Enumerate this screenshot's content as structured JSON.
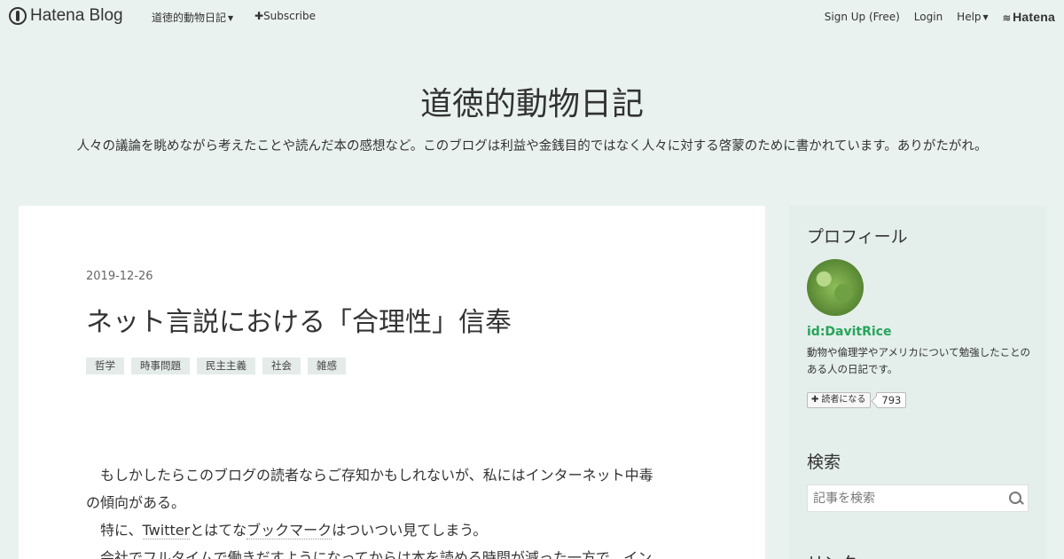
{
  "topbar": {
    "brand": "Hatena Blog",
    "blog_menu": "道徳的動物日記",
    "subscribe": "Subscribe",
    "signup": "Sign Up (Free)",
    "login": "Login",
    "help": "Help",
    "hatena": "Hatena"
  },
  "header": {
    "title": "道徳的動物日記",
    "description": "人々の議論を眺めながら考えたことや読んだ本の感想など。このブログは利益や金銭目的ではなく人々に対する啓蒙のために書かれています。ありがたがれ。"
  },
  "post": {
    "date": "2019-12-26",
    "title": "ネット言説における「合理性」信奉",
    "tags": [
      "哲学",
      "時事問題",
      "民主主義",
      "社会",
      "雑感"
    ],
    "body": {
      "line1": "　もしかしたらこのブログの読者ならご存知かもしれないが、私にはインターネット中毒",
      "line2": "の傾向がある。",
      "line3_pre": "　特に、",
      "line3_link1": "Twitter",
      "line3_mid": "とはてな",
      "line3_link2": "ブックマーク",
      "line3_post": "はついつい見てしまう。",
      "line4": "　会社でフルタイムで働きだすようになってからは本を読める時間が減った一方で、イン"
    }
  },
  "sidebar": {
    "profile_heading": "プロフィール",
    "profile_id": "id:DavitRice",
    "profile_desc": "動物や倫理学やアメリカについて勉強したことのある人の日記です。",
    "subscribe_label": "読者になる",
    "subscriber_count": "793",
    "search_heading": "検索",
    "search_placeholder": "記事を検索",
    "links_heading": "リンク"
  }
}
